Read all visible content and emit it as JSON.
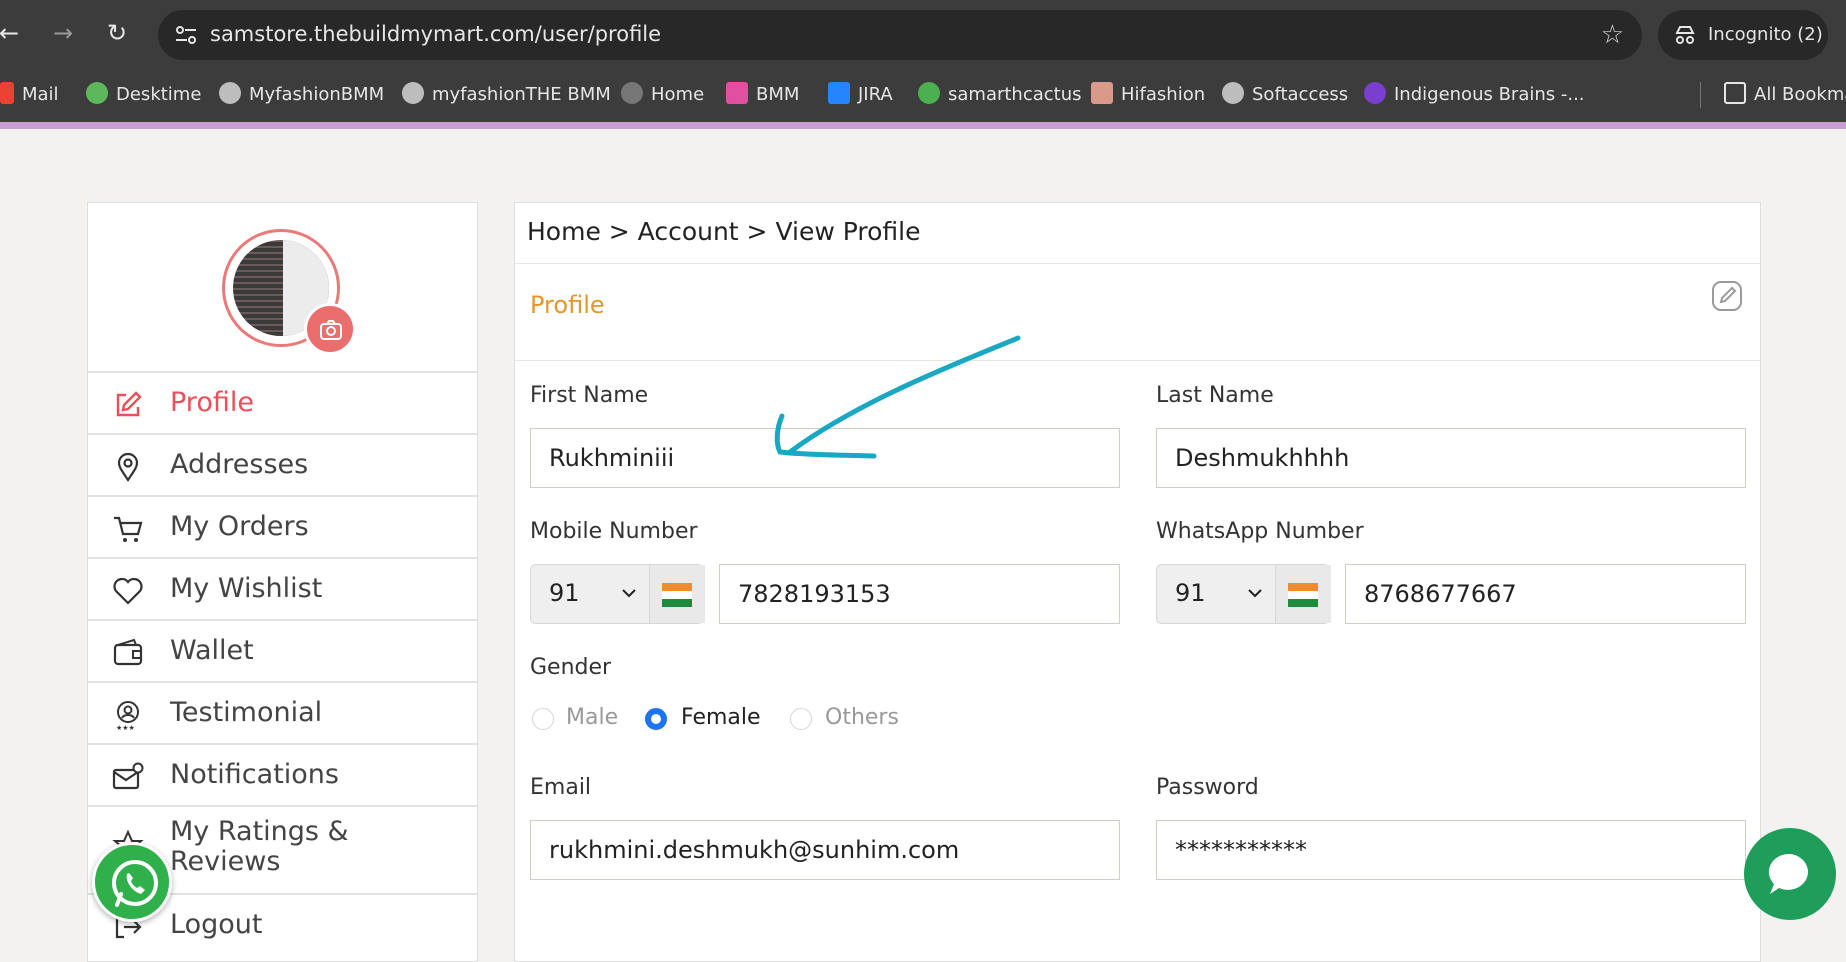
{
  "browser": {
    "url": "samstore.thebuildmymart.com/user/profile",
    "incognito_label": "Incognito (2)",
    "bookmarks": [
      {
        "label": "Mail",
        "icon": "gmail-icon",
        "color": "#ea4335"
      },
      {
        "label": "Desktime",
        "icon": "desktime-icon",
        "color": "#5db85c"
      },
      {
        "label": "MyfashionBMM",
        "icon": "globe-icon",
        "color": "#bdbdbd"
      },
      {
        "label": "myfashionTHE BMM",
        "icon": "globe-icon",
        "color": "#bdbdbd"
      },
      {
        "label": "Home",
        "icon": "globe-icon",
        "color": "#777"
      },
      {
        "label": "BMM",
        "icon": "bmm-icon",
        "color": "#e04fa0"
      },
      {
        "label": "JIRA",
        "icon": "jira-icon",
        "color": "#2684ff"
      },
      {
        "label": "samarthcactus",
        "icon": "cactus-icon",
        "color": "#4caf50"
      },
      {
        "label": "Hifashion",
        "icon": "hifashion-icon",
        "color": "#d99a8a"
      },
      {
        "label": "Softaccess",
        "icon": "globe-icon",
        "color": "#bdbdbd"
      },
      {
        "label": "Indigenous Brains -...",
        "icon": "indigenous-icon",
        "color": "#7b3fd0"
      }
    ],
    "all_bookmarks": "All Bookma"
  },
  "sidebar": {
    "items": [
      {
        "label": "Profile",
        "icon": "edit-icon",
        "active": true
      },
      {
        "label": "Addresses",
        "icon": "location-pin-icon"
      },
      {
        "label": "My Orders",
        "icon": "cart-icon"
      },
      {
        "label": "My Wishlist",
        "icon": "heart-icon"
      },
      {
        "label": "Wallet",
        "icon": "wallet-icon"
      },
      {
        "label": "Testimonial",
        "icon": "testimonial-icon"
      },
      {
        "label": "Notifications",
        "icon": "mail-notification-icon"
      },
      {
        "label": "My Ratings & Reviews",
        "icon": "star-icon"
      },
      {
        "label": "Logout",
        "icon": "logout-icon"
      }
    ]
  },
  "main": {
    "breadcrumb": "Home > Account > View Profile",
    "section_title": "Profile",
    "labels": {
      "first_name": "First Name",
      "last_name": "Last Name",
      "mobile": "Mobile Number",
      "whatsapp": "WhatsApp Number",
      "gender": "Gender",
      "email": "Email",
      "password": "Password"
    },
    "values": {
      "first_name": "Rukhminiii",
      "last_name": "Deshmukhhhh",
      "mobile_code": "91",
      "mobile": "7828193153",
      "whatsapp_code": "91",
      "whatsapp": "8768677667",
      "email": "rukhmini.deshmukh@sunhim.com",
      "password": "***********"
    },
    "gender_options": [
      "Male",
      "Female",
      "Others"
    ],
    "gender_selected": "Female"
  },
  "colors": {
    "accent_red": "#e8505b",
    "section_orange": "#e5972a",
    "annotation_arrow": "#1aa7c4",
    "whatsapp_green": "#2fb04b"
  }
}
